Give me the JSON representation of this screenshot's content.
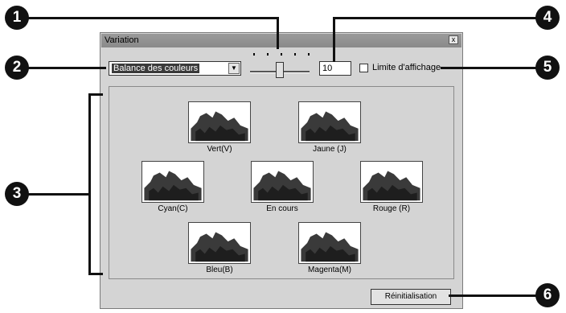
{
  "window": {
    "title": "Variation",
    "close_glyph": "x"
  },
  "controls": {
    "combo_value": "Balance des couleurs",
    "combo_arrow_icon": "chevron-down-icon",
    "intensity_value": "10",
    "limit_checkbox_label": "Limite d'affichage",
    "limit_checked": false
  },
  "previews": [
    {
      "label": "Vert(V)"
    },
    {
      "label": "Jaune (J)"
    },
    {
      "label": "Cyan(C)"
    },
    {
      "label": "En cours"
    },
    {
      "label": "Rouge (R)"
    },
    {
      "label": "Bleu(B)"
    },
    {
      "label": "Magenta(M)"
    }
  ],
  "buttons": {
    "reset_label": "Réinitialisation"
  },
  "callouts": [
    "1",
    "2",
    "3",
    "4",
    "5",
    "6"
  ]
}
